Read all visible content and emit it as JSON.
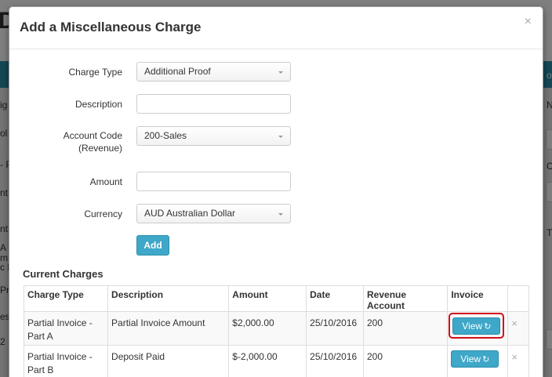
{
  "background": {
    "big_letter": "D",
    "left_fragments": [
      "ig",
      "ol",
      "- P",
      "nt",
      "nt",
      "A",
      "m",
      "c H",
      "Pr",
      "es",
      "2"
    ],
    "right_fragments": [
      "on",
      "N",
      "C",
      "T"
    ]
  },
  "modal": {
    "title": "Add a Miscellaneous Charge",
    "close_label": "×",
    "form": {
      "charge_type_label": "Charge Type",
      "charge_type_value": "Additional Proof",
      "description_label": "Description",
      "description_value": "",
      "account_code_label_line1": "Account Code",
      "account_code_label_line2": "(Revenue)",
      "account_code_value": "200-Sales",
      "amount_label": "Amount",
      "amount_value": "",
      "currency_label": "Currency",
      "currency_value": "AUD Australian Dollar",
      "add_button": "Add"
    },
    "current_charges": {
      "title": "Current Charges",
      "columns": [
        "Charge Type",
        "Description",
        "Amount",
        "Date",
        "Revenue Account",
        "Invoice"
      ],
      "rows": [
        {
          "charge_type_line1": "Partial Invoice -",
          "charge_type_line2": "Part A",
          "description": "Partial Invoice Amount",
          "amount": "$2,000.00",
          "date": "25/10/2016",
          "revenue_account": "200",
          "invoice_button": "View",
          "delete": "×"
        },
        {
          "charge_type_line1": "Partial Invoice -",
          "charge_type_line2": "Part B",
          "description": "Deposit Paid",
          "amount": "$-2,000.00",
          "date": "25/10/2016",
          "revenue_account": "200",
          "invoice_button": "View",
          "delete": "×"
        }
      ]
    }
  },
  "colors": {
    "accent": "#3fa7c8",
    "highlight": "#d0101a",
    "header_band": "#2a8fa8"
  }
}
